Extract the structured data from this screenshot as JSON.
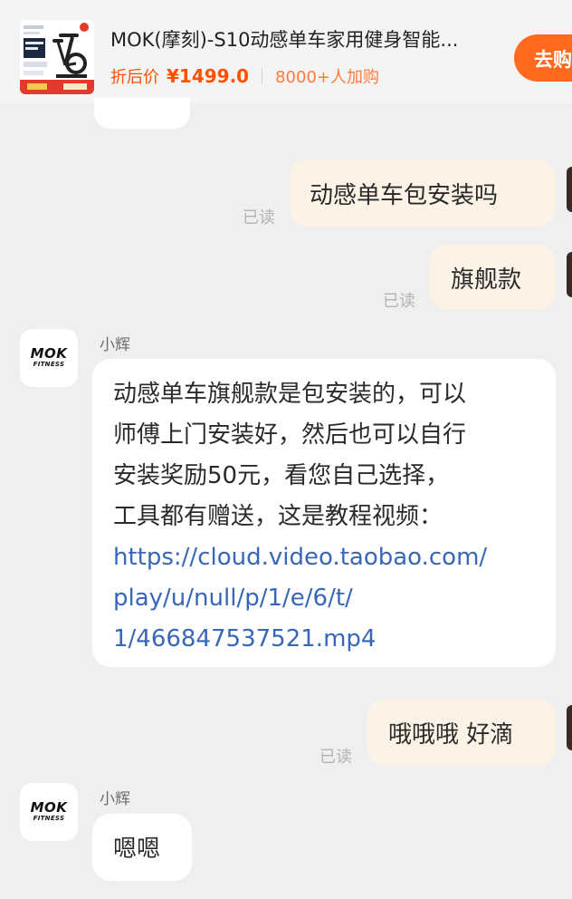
{
  "product": {
    "title": "MOK(摩刻)-S10动感单车家用健身智能...",
    "price_label": "折后价",
    "price": "¥1499.0",
    "cart_count": "8000+人加购",
    "buy_button": "去购买"
  },
  "messages": {
    "m1": {
      "text": "动感单车包安装吗",
      "status": "已读"
    },
    "m2": {
      "text": "旗舰款",
      "status": "已读"
    },
    "m3": {
      "sender": "小辉",
      "lines": [
        "动感单车旗舰款是包安装的，可以",
        "师傅上门安装好，然后也可以自行",
        "安装奖励50元，看您自己选择，",
        "工具都有赠送，这是教程视频："
      ],
      "link_lines": [
        "https://cloud.video.taobao.com/",
        "play/u/null/p/1/e/6/t/",
        "1/466847537521.mp4"
      ]
    },
    "m4": {
      "text": "哦哦哦 好滴",
      "status": "已读"
    },
    "m5": {
      "sender": "小辉",
      "text": "嗯嗯"
    }
  },
  "brand_logo": {
    "main": "MOK",
    "sub": "FITNESS"
  },
  "icons": [
    "spin-bike-thumbnail",
    "brand-avatar"
  ],
  "colors": {
    "accent": "#ff5000",
    "buy_button": "#ff6a1f",
    "own_bubble": "#fcf3e6",
    "other_bubble": "#ffffff",
    "link": "#3866b8",
    "background": "#efeff0"
  }
}
